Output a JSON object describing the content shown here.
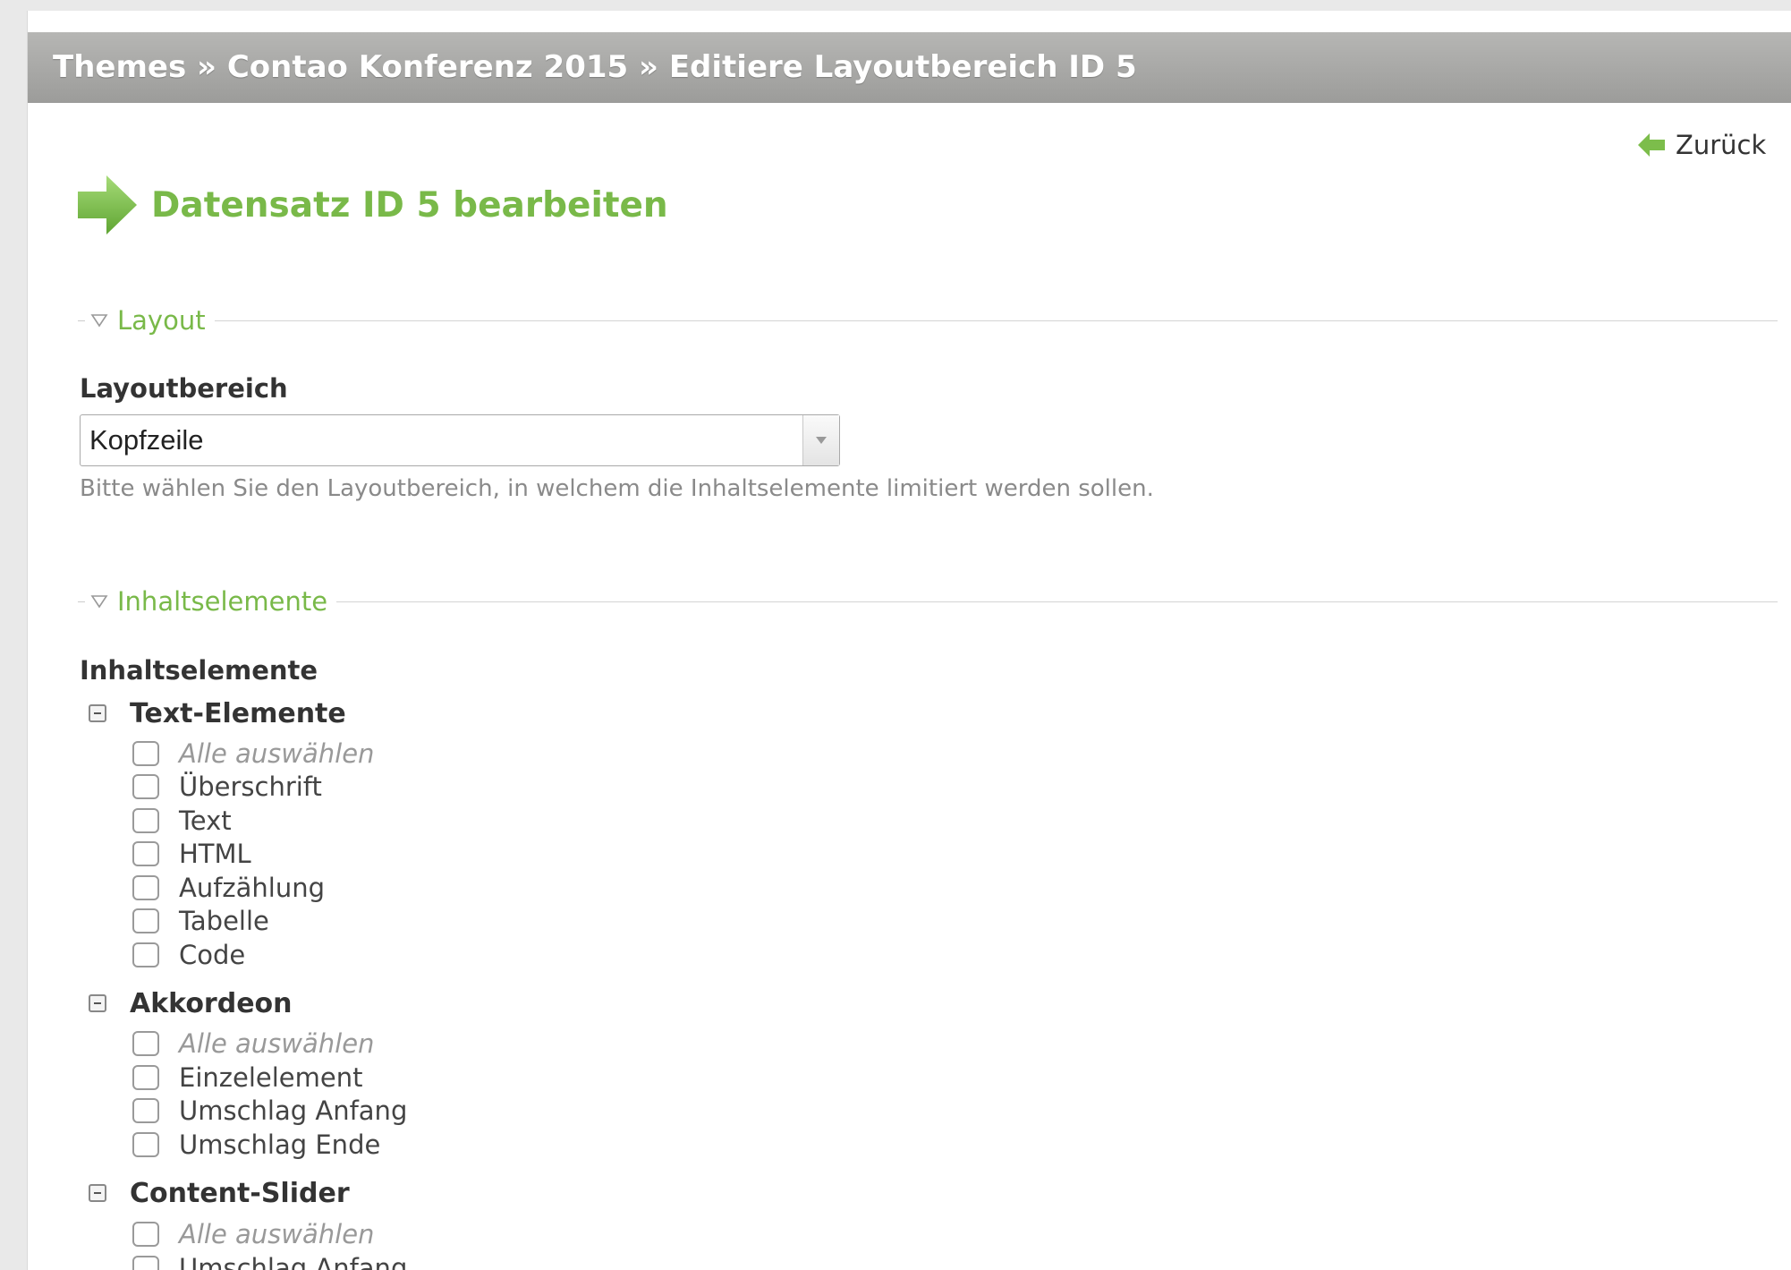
{
  "breadcrumb": "Themes » Contao Konferenz 2015 » Editiere Layoutbereich ID 5",
  "back_label": "Zurück",
  "headline": "Datensatz ID 5 bearbeiten",
  "sections": {
    "layout": "Layout",
    "content": "Inhaltselemente"
  },
  "layout_field": {
    "label": "Layoutbereich",
    "value": "Kopfzeile",
    "help": "Bitte wählen Sie den Layoutbereich, in welchem die Inhaltselemente limitiert werden sollen."
  },
  "content_field": {
    "label": "Inhaltselemente",
    "groups": [
      {
        "name": "Text-Elemente",
        "options": [
          "Alle auswählen",
          "Überschrift",
          "Text",
          "HTML",
          "Aufzählung",
          "Tabelle",
          "Code"
        ]
      },
      {
        "name": "Akkordeon",
        "options": [
          "Alle auswählen",
          "Einzelelement",
          "Umschlag Anfang",
          "Umschlag Ende"
        ]
      },
      {
        "name": "Content-Slider",
        "options": [
          "Alle auswählen",
          "Umschlag Anfang"
        ]
      }
    ]
  },
  "colors": {
    "accent": "#79b949",
    "header_bar": "#a8a8a6"
  },
  "icons": {
    "back": "green-arrow-left-icon",
    "headline": "green-arrow-right-icon",
    "legend": "triangle-down-icon",
    "group_toggle": "minus-square-icon",
    "select": "chevron-down-icon"
  }
}
